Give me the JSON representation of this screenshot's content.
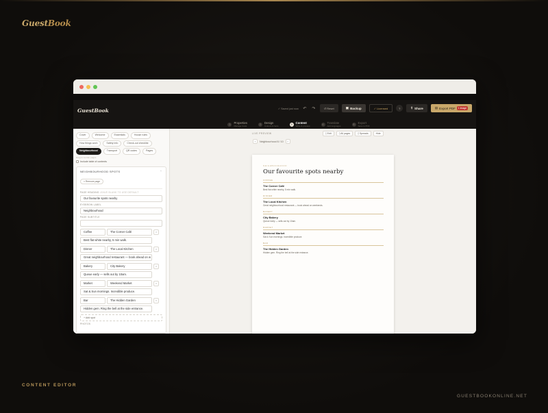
{
  "brand": {
    "name_part1": "Guest",
    "name_part2": "Book"
  },
  "footer": {
    "left": "CONTENT EDITOR",
    "right": "GUESTBOOKONLINE.NET"
  },
  "app": {
    "logo": "GuestBook",
    "saved_text": "✓ Saved just now",
    "undo_icon": "undo-icon",
    "redo_icon": "redo-icon",
    "reset_label": "↺ Reset",
    "backup_label": "Backup",
    "licensed_label": "✓ Licensed",
    "help_label": "?",
    "share_label": "Share",
    "export_label": "Export PDF",
    "export_badge": "1 image"
  },
  "steps": [
    {
      "num": "1",
      "label": "Properties",
      "sub": "Manage hosts"
    },
    {
      "num": "2",
      "label": "Design",
      "sub": "Colours & fonts"
    },
    {
      "num": "3",
      "label": "Content",
      "sub": "Write & preview"
    },
    {
      "num": "4",
      "label": "Translate",
      "sub": "Add languages"
    },
    {
      "num": "5",
      "label": "Export",
      "sub": "Save to PDF"
    }
  ],
  "sidebar": {
    "chips": [
      "Cover",
      "Welcome",
      "Essentials",
      "House rules",
      "How things work",
      "Safety info",
      "Check-out checklist",
      "Neighbourhood",
      "Transport",
      "QR codes",
      "Pages"
    ],
    "drag_hint": "Drag to reorder pages",
    "include_toc": "Include table of contents",
    "panel": {
      "title": "NEIGHBOURHOOD SPOTS",
      "remove_label": "× Remove page",
      "heading_label": "PAGE HEADING",
      "heading_hint": "LEAVE BLANK TO USE DEFAULT",
      "heading_value": "Our favourite spots nearby",
      "eyebrow_label": "EYEBROW LABEL",
      "eyebrow_value": "Neighbourhood",
      "subtitle_label": "PAGE SUBTITLE",
      "subtitle_value": "",
      "spots": [
        {
          "category": "Coffee",
          "name": "The Corner Café",
          "desc": "Best flat white nearby, 5 min walk."
        },
        {
          "category": "Dinner",
          "name": "The Local Kitchen",
          "desc": "Great neighbourhood restaurant — book ahead on w"
        },
        {
          "category": "Bakery",
          "name": "City Bakery",
          "desc": "Queue early — sells out by 10am."
        },
        {
          "category": "Market",
          "name": "Weekend Market",
          "desc": "Sat & Sun mornings. Incredible produce."
        },
        {
          "category": "Bar",
          "name": "The Hidden Garden",
          "desc": "Hidden gem. Ring the bell at the side entrance."
        }
      ],
      "add_spot": "+ Add spot",
      "photos_label": "PHOTOS"
    }
  },
  "preview": {
    "label": "LIVE PREVIEW",
    "views": [
      "▯ Edit",
      "▯ All pages",
      "▯ Spreads",
      "Hide"
    ],
    "pager_text": "Neighbourhood  8 / 10",
    "page": {
      "eyebrow": "NEIGHBOURHOOD",
      "title": "Our favourite spots nearby",
      "entries": [
        {
          "cat": "COFFEE",
          "name": "The Corner Café",
          "desc": "Best flat white nearby, 5 min walk."
        },
        {
          "cat": "DINNER",
          "name": "The Local Kitchen",
          "desc": "Great neighbourhood restaurant — book ahead on weekends."
        },
        {
          "cat": "BAKERY",
          "name": "City Bakery",
          "desc": "Queue early — sells out by 10am."
        },
        {
          "cat": "MARKET",
          "name": "Weekend Market",
          "desc": "Sat & Sun mornings. Incredible produce."
        },
        {
          "cat": "BAR",
          "name": "The Hidden Garden",
          "desc": "Hidden gem. Ring the bell at the side entrance."
        }
      ]
    }
  },
  "colors": {
    "accent": "#c9a86a",
    "background": "#0f0d0b",
    "header": "#161412"
  }
}
